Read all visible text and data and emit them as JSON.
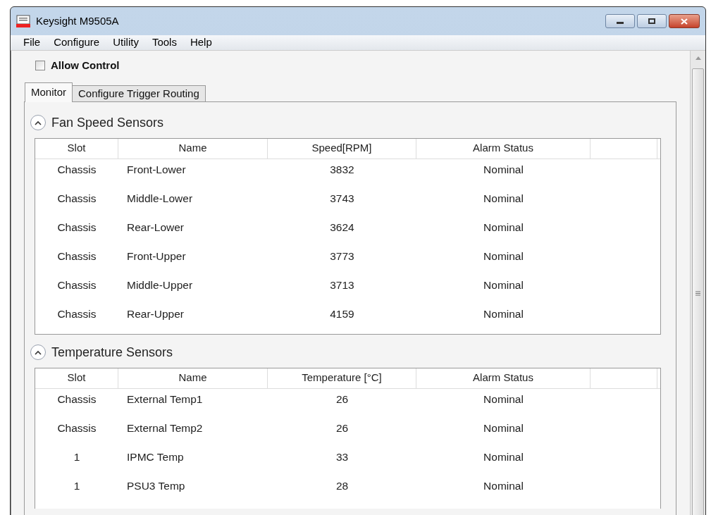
{
  "window": {
    "title": "Keysight M9505A"
  },
  "menu": [
    "File",
    "Configure",
    "Utility",
    "Tools",
    "Help"
  ],
  "allow_control": {
    "label": "Allow Control",
    "checked": false
  },
  "tabs": [
    {
      "label": "Monitor",
      "selected": true
    },
    {
      "label": "Configure Trigger Routing",
      "selected": false
    }
  ],
  "sections": [
    {
      "title": "Fan Speed Sensors",
      "expanded": true,
      "columns": [
        "Slot",
        "Name",
        "Speed[RPM]",
        "Alarm Status"
      ],
      "rows": [
        [
          "Chassis",
          "Front-Lower",
          "3832",
          "Nominal"
        ],
        [
          "Chassis",
          "Middle-Lower",
          "3743",
          "Nominal"
        ],
        [
          "Chassis",
          "Rear-Lower",
          "3624",
          "Nominal"
        ],
        [
          "Chassis",
          "Front-Upper",
          "3773",
          "Nominal"
        ],
        [
          "Chassis",
          "Middle-Upper",
          "3713",
          "Nominal"
        ],
        [
          "Chassis",
          "Rear-Upper",
          "4159",
          "Nominal"
        ]
      ]
    },
    {
      "title": "Temperature Sensors",
      "expanded": true,
      "columns": [
        "Slot",
        "Name",
        "Temperature [°C]",
        "Alarm Status"
      ],
      "rows": [
        [
          "Chassis",
          "External Temp1",
          "26",
          "Nominal"
        ],
        [
          "Chassis",
          "External Temp2",
          "26",
          "Nominal"
        ],
        [
          "1",
          "IPMC Temp",
          "33",
          "Nominal"
        ],
        [
          "1",
          "PSU3 Temp",
          "28",
          "Nominal"
        ]
      ]
    }
  ]
}
